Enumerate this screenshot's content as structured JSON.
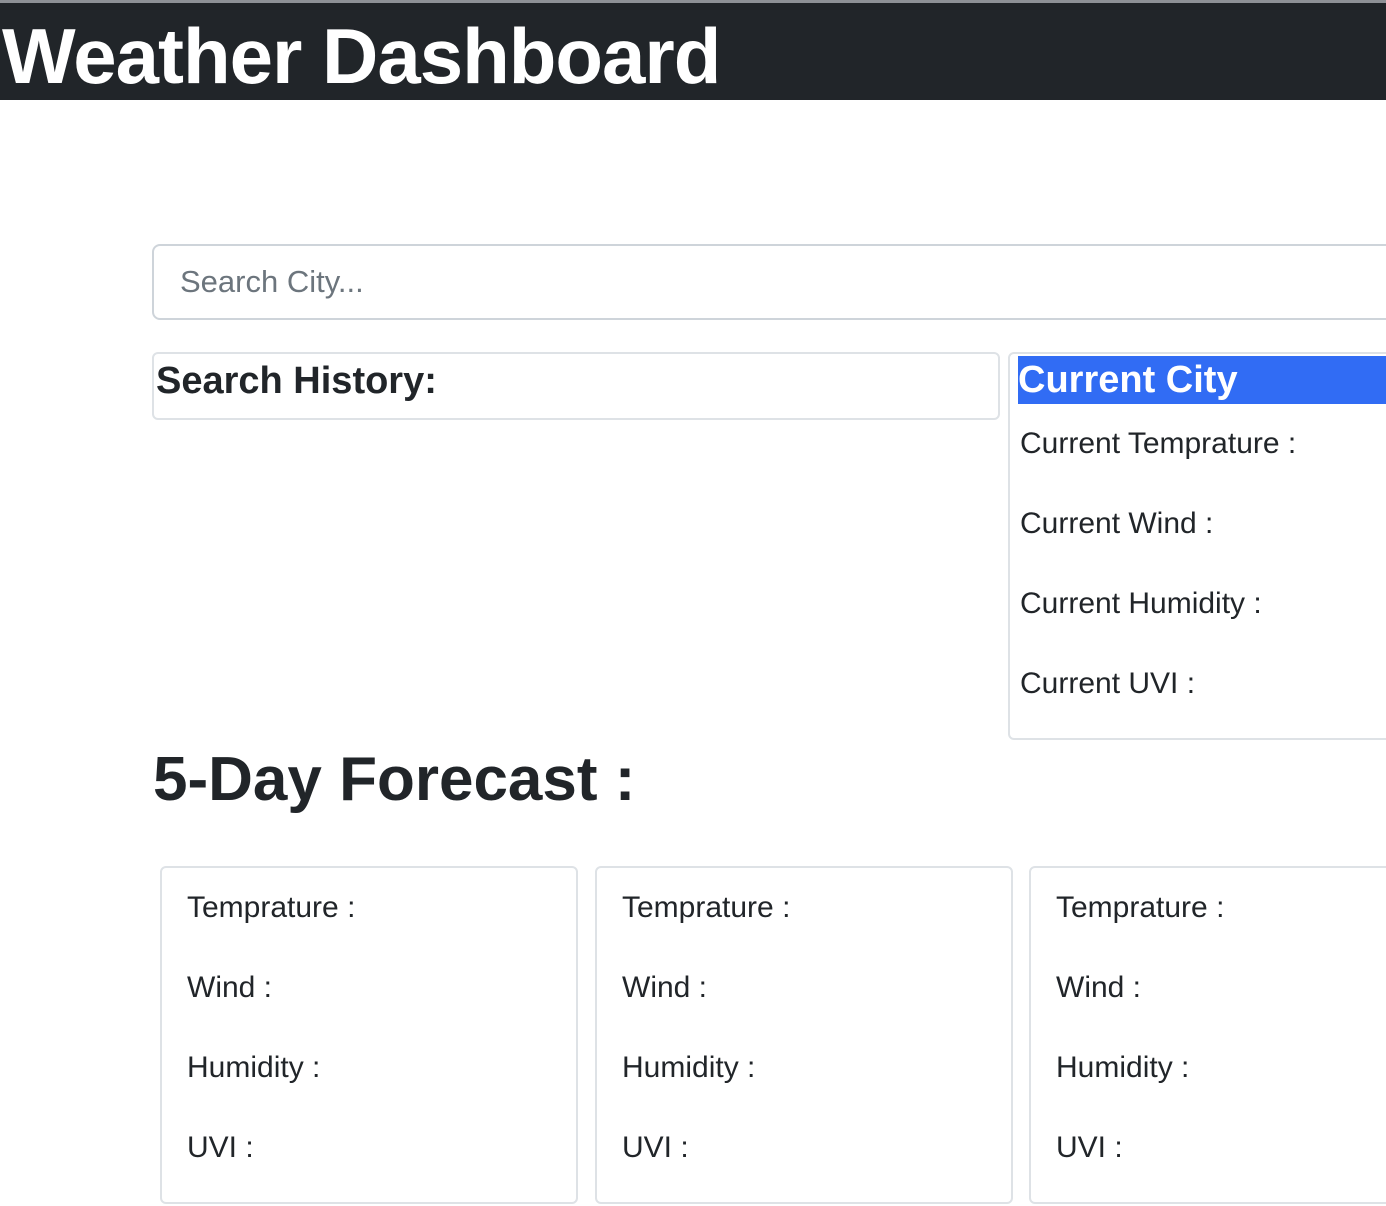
{
  "header": {
    "title": "Weather Dashboard"
  },
  "search": {
    "placeholder": "Search City...",
    "value": ""
  },
  "history": {
    "title": "Search History:"
  },
  "current": {
    "city": "Current City",
    "temperature_label": "Current Temprature :",
    "wind_label": "Current Wind :",
    "humidity_label": "Current Humidity :",
    "uvi_label": "Current UVI :"
  },
  "forecast": {
    "heading": "5-Day Forecast :",
    "cards": [
      {
        "temperature_label": "Temprature :",
        "wind_label": "Wind :",
        "humidity_label": "Humidity :",
        "uvi_label": "UVI :"
      },
      {
        "temperature_label": "Temprature :",
        "wind_label": "Wind :",
        "humidity_label": "Humidity :",
        "uvi_label": "UVI :"
      },
      {
        "temperature_label": "Temprature :",
        "wind_label": "Wind :",
        "humidity_label": "Humidity :",
        "uvi_label": "UVI :"
      }
    ]
  },
  "colors": {
    "header_bg": "#212529",
    "current_city_bg": "#316cf4",
    "border": "#dee2e6",
    "placeholder": "#6c757d"
  }
}
